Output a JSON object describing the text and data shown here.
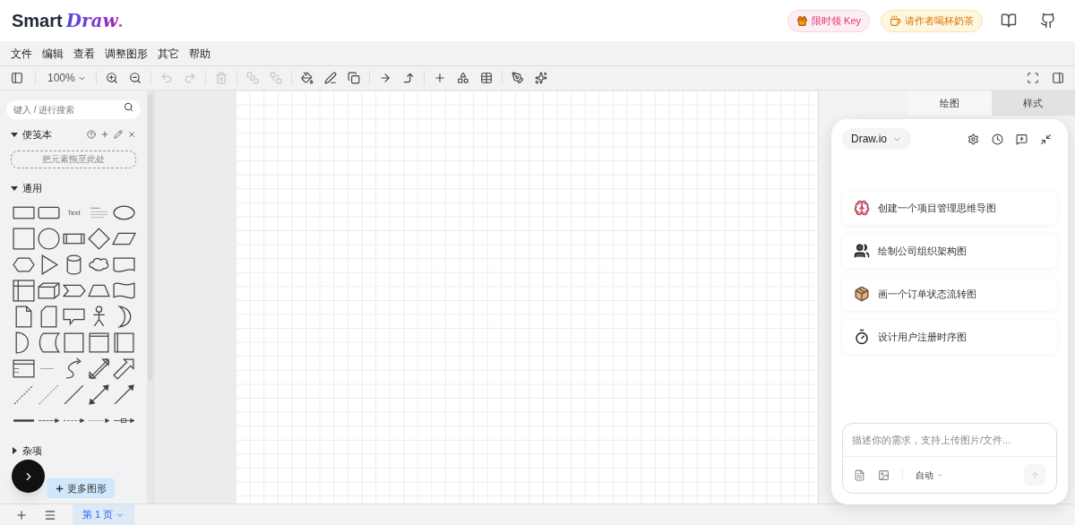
{
  "app": {
    "logo_plain": "Smart",
    "logo_accent": "Draw",
    "logo_dot": "."
  },
  "header_buttons": [
    {
      "kind": "gift",
      "label": "限时领 Key"
    },
    {
      "kind": "coffee",
      "label": "请作者喝杯奶茶"
    }
  ],
  "menu": [
    "文件",
    "编辑",
    "查看",
    "调整图形",
    "其它",
    "帮助"
  ],
  "toolbar": {
    "zoom": "100%",
    "groups": [
      [
        {
          "kind": "zoom-in",
          "disabled": false
        },
        {
          "kind": "zoom-out",
          "disabled": false
        }
      ],
      [
        {
          "kind": "undo",
          "disabled": true
        },
        {
          "kind": "redo",
          "disabled": true
        }
      ],
      [
        {
          "kind": "delete",
          "disabled": true
        }
      ],
      [
        {
          "kind": "to-front",
          "disabled": true
        },
        {
          "kind": "to-back",
          "disabled": true
        }
      ],
      [
        {
          "kind": "fill",
          "disabled": false
        },
        {
          "kind": "line",
          "disabled": false
        },
        {
          "kind": "shadow",
          "disabled": false
        }
      ],
      [
        {
          "kind": "connection",
          "disabled": false
        },
        {
          "kind": "waypoints",
          "disabled": false
        }
      ],
      [
        {
          "kind": "insert",
          "disabled": false
        },
        {
          "kind": "shapes",
          "disabled": false
        },
        {
          "kind": "table",
          "disabled": false
        }
      ],
      [
        {
          "kind": "edit",
          "disabled": false
        },
        {
          "kind": "magic",
          "disabled": false
        }
      ]
    ]
  },
  "sidebar": {
    "search_placeholder": "键入 / 进行搜索",
    "scratchpad": {
      "title": "便笺本",
      "expanded": true,
      "drop_hint": "把元素拖至此处"
    },
    "general": {
      "title": "通用",
      "expanded": true,
      "text_shape": "Text"
    },
    "misc": {
      "title": "杂项",
      "expanded": false
    },
    "more_button": "更多图形"
  },
  "panel_tabs": [
    {
      "label": "绘图",
      "selected": true
    },
    {
      "label": "样式",
      "selected": false
    }
  ],
  "chat": {
    "model": "Draw.io",
    "suggestions": [
      {
        "kind": "brain",
        "text": "创建一个项目管理思维导图"
      },
      {
        "kind": "people",
        "text": "绘制公司组织架构图"
      },
      {
        "kind": "box",
        "text": "画一个订单状态流转图"
      },
      {
        "kind": "timer",
        "text": "设计用户注册时序图"
      }
    ],
    "input": {
      "placeholder": "描述你的需求，支持上传图片/文件...",
      "mode": "自动"
    }
  },
  "pages": [
    {
      "label": "第 1 页",
      "selected": true
    }
  ]
}
